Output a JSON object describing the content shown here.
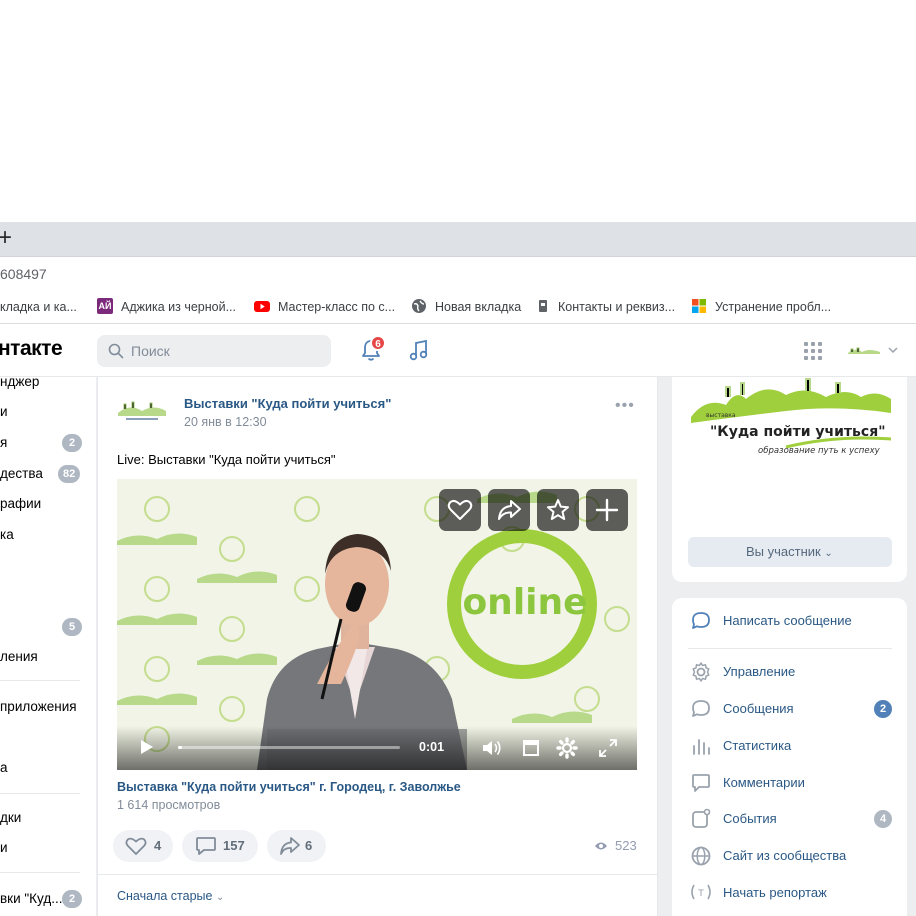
{
  "browser": {
    "new_tab_symbol": "+",
    "address_fragment": "608497",
    "bookmarks": [
      {
        "label": "кладка и ка...",
        "icon": "bookmark-icon"
      },
      {
        "label": "Аджика из черной...",
        "icon": "aj-site-icon",
        "icon_text": "АЙ"
      },
      {
        "label": "Мастер-класс по с...",
        "icon": "youtube-icon"
      },
      {
        "label": "Новая вкладка",
        "icon": "globe-icon"
      },
      {
        "label": "Контакты и реквиз...",
        "icon": "site-icon"
      },
      {
        "label": "Устранение пробл...",
        "icon": "windows-icon"
      }
    ]
  },
  "header": {
    "logo_text": "нтакте",
    "search_placeholder": "Поиск",
    "notifications_count": "6"
  },
  "sidebar": {
    "items": [
      {
        "label": "нджер"
      },
      {
        "label": "и"
      },
      {
        "label": "я",
        "badge": "2"
      },
      {
        "label": "дества",
        "badge": "82"
      },
      {
        "label": "рафии"
      },
      {
        "label": "ка"
      },
      {
        "label": ""
      },
      {
        "label": ""
      },
      {
        "label": "",
        "badge": "5"
      },
      {
        "label": "ления"
      },
      {
        "label": "приложения"
      },
      {
        "label": ""
      },
      {
        "label": "а"
      },
      {
        "label": "дки"
      },
      {
        "label": "и"
      },
      {
        "label": "вки \"Куд...",
        "badge": "2"
      }
    ]
  },
  "post": {
    "author": "Выставки \"Куда пойти учиться\"",
    "date": "20 янв в 12:30",
    "more": "•••",
    "text": "Live: Выставки \"Куда пойти учиться\"",
    "video": {
      "time": "0:01",
      "progress": 0.02,
      "bg_word": "online",
      "title": "Выставка \"Куда пойти учиться\" г. Городец, г. Заволжье",
      "views": "1 614 просмотров"
    },
    "actions": {
      "likes": "4",
      "comments": "157",
      "shares": "6",
      "views": "523"
    },
    "sort_label": "Сначала старые"
  },
  "right": {
    "cover": {
      "small": "выставка",
      "title": "\"Куда пойти учиться\"",
      "tagline": "образование путь к успеху"
    },
    "member_button": "Вы участник",
    "write_message": "Написать сообщение",
    "menu": [
      {
        "label": "Управление",
        "icon": "gear-icon"
      },
      {
        "label": "Сообщения",
        "icon": "message-icon",
        "badge": "2",
        "badge_color": "#5181b8"
      },
      {
        "label": "Статистика",
        "icon": "stats-icon"
      },
      {
        "label": "Комментарии",
        "icon": "comment-icon"
      },
      {
        "label": "События",
        "icon": "events-icon",
        "badge": "4",
        "badge_color": "#aeb7c2"
      },
      {
        "label": "Сайт из сообщества",
        "icon": "globe-icon"
      },
      {
        "label": "Начать репортаж",
        "icon": "broadcast-icon"
      }
    ]
  },
  "colors": {
    "vk_link": "#2a5885",
    "badge_grey": "#aeb7c2",
    "badge_blue": "#5181b8",
    "notification_red": "#e64646",
    "brand_green": "#8cc63f"
  }
}
